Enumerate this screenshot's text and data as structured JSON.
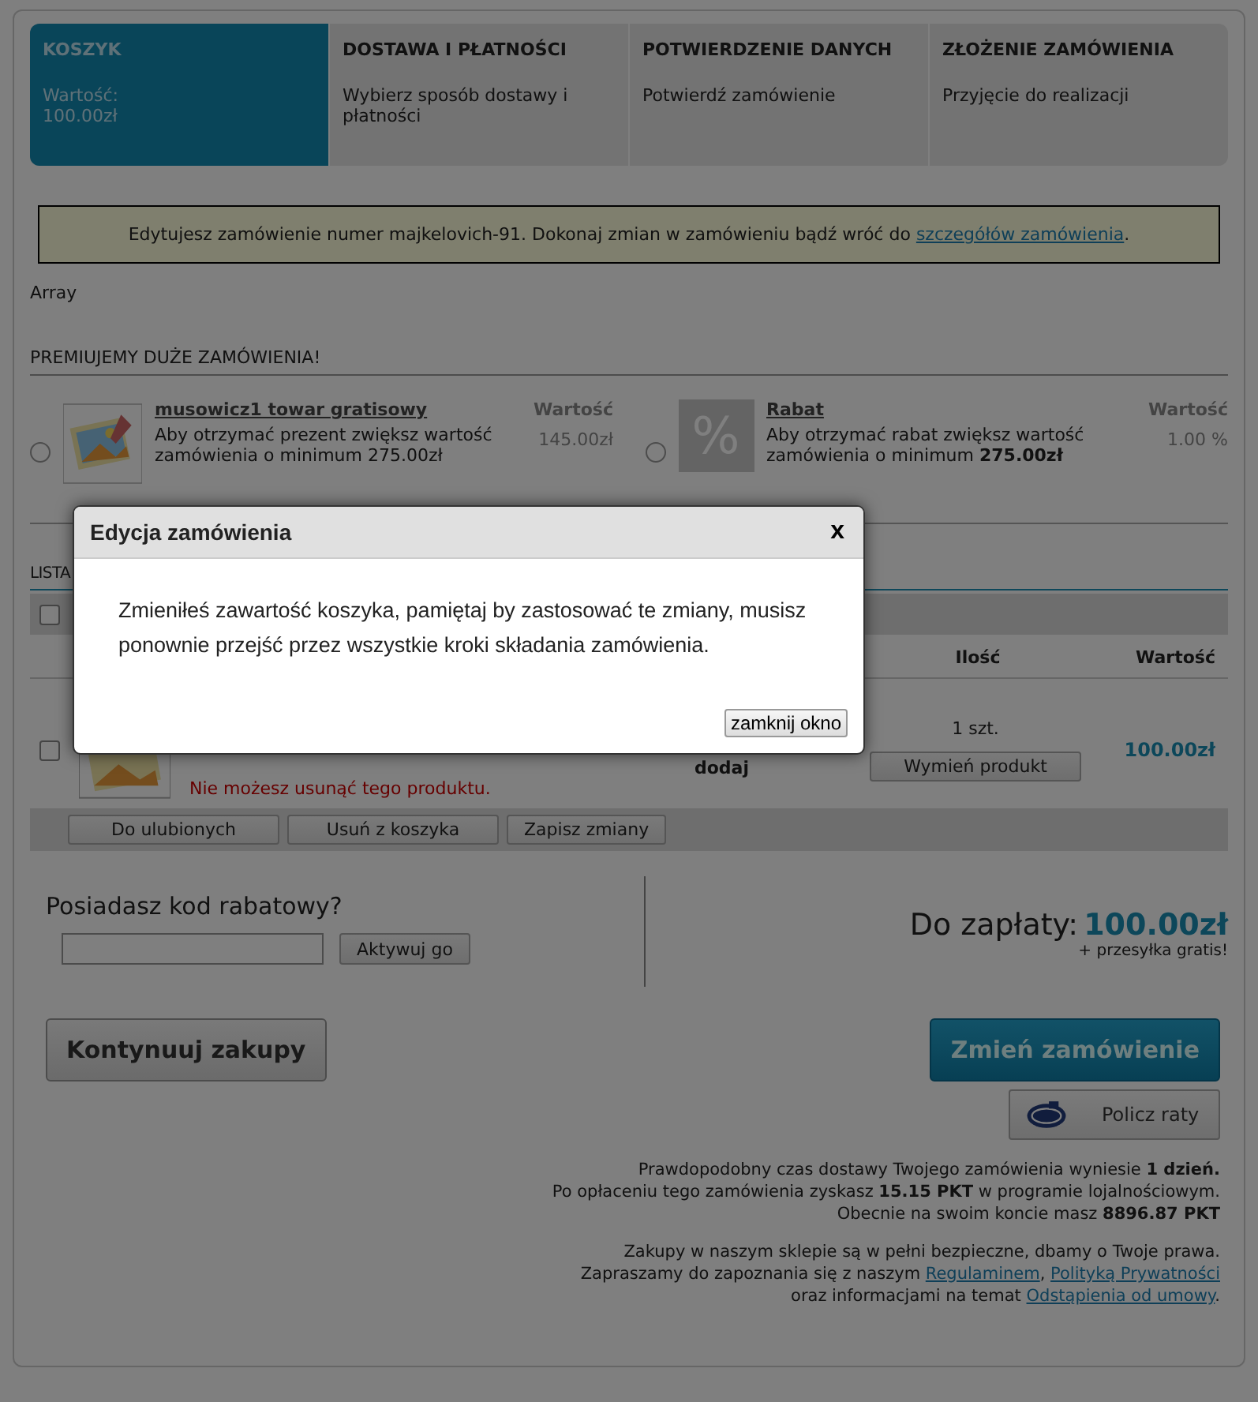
{
  "steps": [
    {
      "title": "KOSZYK",
      "lines": [
        "Wartość:",
        "100.00zł"
      ],
      "selected": true
    },
    {
      "title": "DOSTAWA I PŁATNOŚCI",
      "lines": [
        "Wybierz sposób dostawy i płatności"
      ],
      "selected": false
    },
    {
      "title": "POTWIERDZENIE DANYCH",
      "lines": [
        "Potwierdź zamówienie"
      ],
      "selected": false
    },
    {
      "title": "ZŁOŻENIE ZAMÓWIENIA",
      "lines": [
        "Przyjęcie do realizacji"
      ],
      "selected": false
    }
  ],
  "notice": {
    "text": "Edytujesz zamówienie numer majkelovich-91. Dokonaj zmian w zamówieniu bądź wróć do ",
    "link": "szczegółów zamówienia",
    "end": "."
  },
  "debug_text": "Array",
  "premium": {
    "heading": "PREMIUJEMY DUŻE ZAMÓWIENIA!",
    "items": [
      {
        "kind": "gift",
        "title": "musowicz1 towar gratisowy",
        "description": "Aby otrzymać prezent zwiększ wartość zamówienia o minimum 275.00zł",
        "value_label": "Wartość",
        "value": "145.00zł",
        "selected": false
      },
      {
        "kind": "discount",
        "glyph": "%",
        "title": "Rabat",
        "description": "Aby otrzymać rabat zwiększ wartość zamówienia o minimum **275.00zł**",
        "value_label": "Wartość",
        "value": "1.00 %",
        "selected": false
      }
    ]
  },
  "cart": {
    "heading": "LISTA",
    "select_all": {
      "checked": false
    },
    "columns": [
      "Ilość",
      "Wartość"
    ],
    "item": {
      "checked": false,
      "fragment": "dodaj",
      "warning": "Nie możesz usunąć tego produktu.",
      "quantity": "1 szt.",
      "replace_button": "Wymień produkt",
      "price": "100.00zł"
    },
    "actions": [
      "Do ulubionych",
      "Usuń z koszyka",
      "Zapisz zmiany"
    ]
  },
  "coupon": {
    "label": "Posiadasz kod rabatowy?",
    "button": "Aktywuj go"
  },
  "total": {
    "label": "Do zapłaty:",
    "amount": "100.00zł",
    "shipping": "+ przesyłka gratis!"
  },
  "continue_button": "Kontynuuj zakupy",
  "change_button": "Zmień zamówienie",
  "installments_button": "Policz raty",
  "info": [
    "Prawdopodobny czas dostawy Twojego zamówienia wyniesie **1 dzień.**",
    "Po opłaceniu tego zamówienia zyskasz **15.15 PKT** w programie lojalnościowym.",
    "Obecnie na swoim koncie masz **8896.87 PKT**"
  ],
  "legal": [
    [
      {
        "text": "Zakupy w naszym sklepie są w pełni bezpieczne, dbamy o Twoje prawa."
      }
    ],
    [
      {
        "text": "Zapraszamy do zapoznania się z naszym "
      },
      {
        "link": "Regulaminem"
      },
      {
        "text": ", "
      },
      {
        "link": "Polityką Prywatności "
      }
    ],
    [
      {
        "text": "oraz informacjami na temat "
      },
      {
        "link": "Odstąpienia od umowy"
      },
      {
        "text": "."
      }
    ]
  ],
  "modal": {
    "title": "Edycja zamówienia",
    "close": "x",
    "message": "Zmieniłeś zawartość koszyka, pamiętaj by zastosować te zmiany, musisz ponownie przejść przez wszystkie kroki składania zamówienia.",
    "button": "zamknij okno"
  }
}
